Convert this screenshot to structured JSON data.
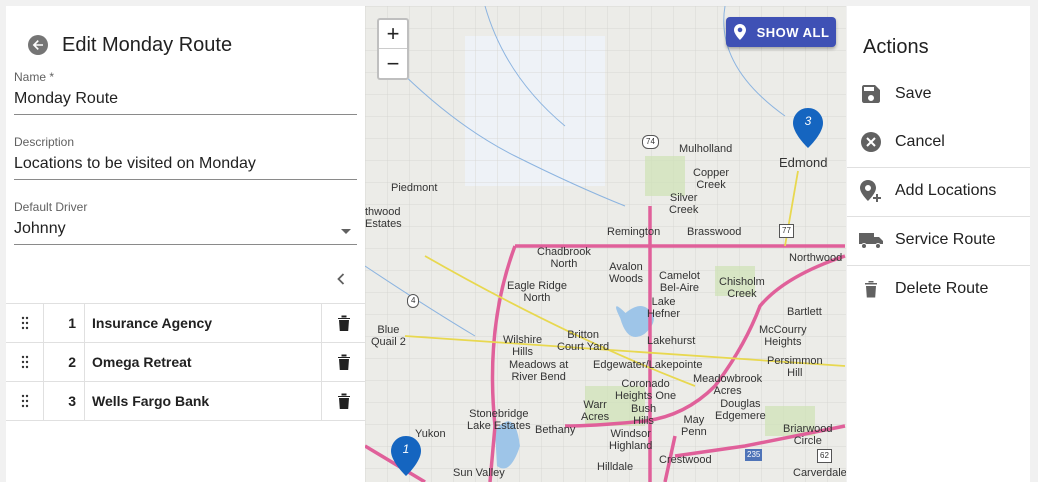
{
  "editor": {
    "title": "Edit Monday Route",
    "name_label": "Name *",
    "name_value": "Monday Route",
    "description_label": "Description",
    "description_value": "Locations to be visited on Monday",
    "driver_label": "Default Driver",
    "driver_value": "Johnny"
  },
  "stops": [
    {
      "num": "1",
      "name": "Insurance Agency"
    },
    {
      "num": "2",
      "name": "Omega Retreat"
    },
    {
      "num": "3",
      "name": "Wells Fargo Bank"
    }
  ],
  "map": {
    "zoom_in": "+",
    "zoom_out": "−",
    "show_all_label": "SHOW ALL",
    "pins": [
      {
        "label": "3"
      },
      {
        "label": "1"
      }
    ],
    "places": [
      "Piedmont",
      "thwood",
      "Estates",
      "Mulholland",
      "Copper",
      "Creek",
      "Silver",
      "Creek",
      "Edmond",
      "Remington",
      "Brasswood",
      "Chadbrook",
      "North",
      "Avalon",
      "Woods",
      "Camelot",
      "Bel-Aire",
      "Chisholm",
      "Creek",
      "Northwood",
      "Eagle Ridge",
      "North",
      "Lake",
      "Hefner",
      "Bartlett",
      "Blue",
      "Quail 2",
      "Wilshire",
      "Hills",
      "Britton",
      "Court Yard",
      "Lakehurst",
      "McCourry",
      "Heights",
      "Meadows at",
      "River Bend",
      "Edgewater/Lakepointe",
      "Persimmon",
      "Hill",
      "Coronado",
      "Heights One",
      "Meadowbrook",
      "Acres",
      "Warr",
      "Acres",
      "Bush",
      "Hills",
      "Douglas",
      "Edgemere",
      "Stonebridge",
      "Lake Estates",
      "Bethany",
      "Windsor",
      "Highland",
      "May",
      "Penn",
      "Briarwood",
      "Circle",
      "Yukon",
      "Sun Valley",
      "Hilldale",
      "Crestwood",
      "Carverdale",
      "74",
      "77",
      "4",
      "235",
      "62"
    ]
  },
  "actions": {
    "title": "Actions",
    "items": [
      {
        "label": "Save"
      },
      {
        "label": "Cancel"
      },
      {
        "label": "Add Locations"
      },
      {
        "label": "Service Route"
      },
      {
        "label": "Delete Route"
      }
    ]
  },
  "colors": {
    "accent": "#3f51b5",
    "pin": "#1565c0",
    "highway": "#e0609a",
    "lake": "#9ec5e8"
  }
}
